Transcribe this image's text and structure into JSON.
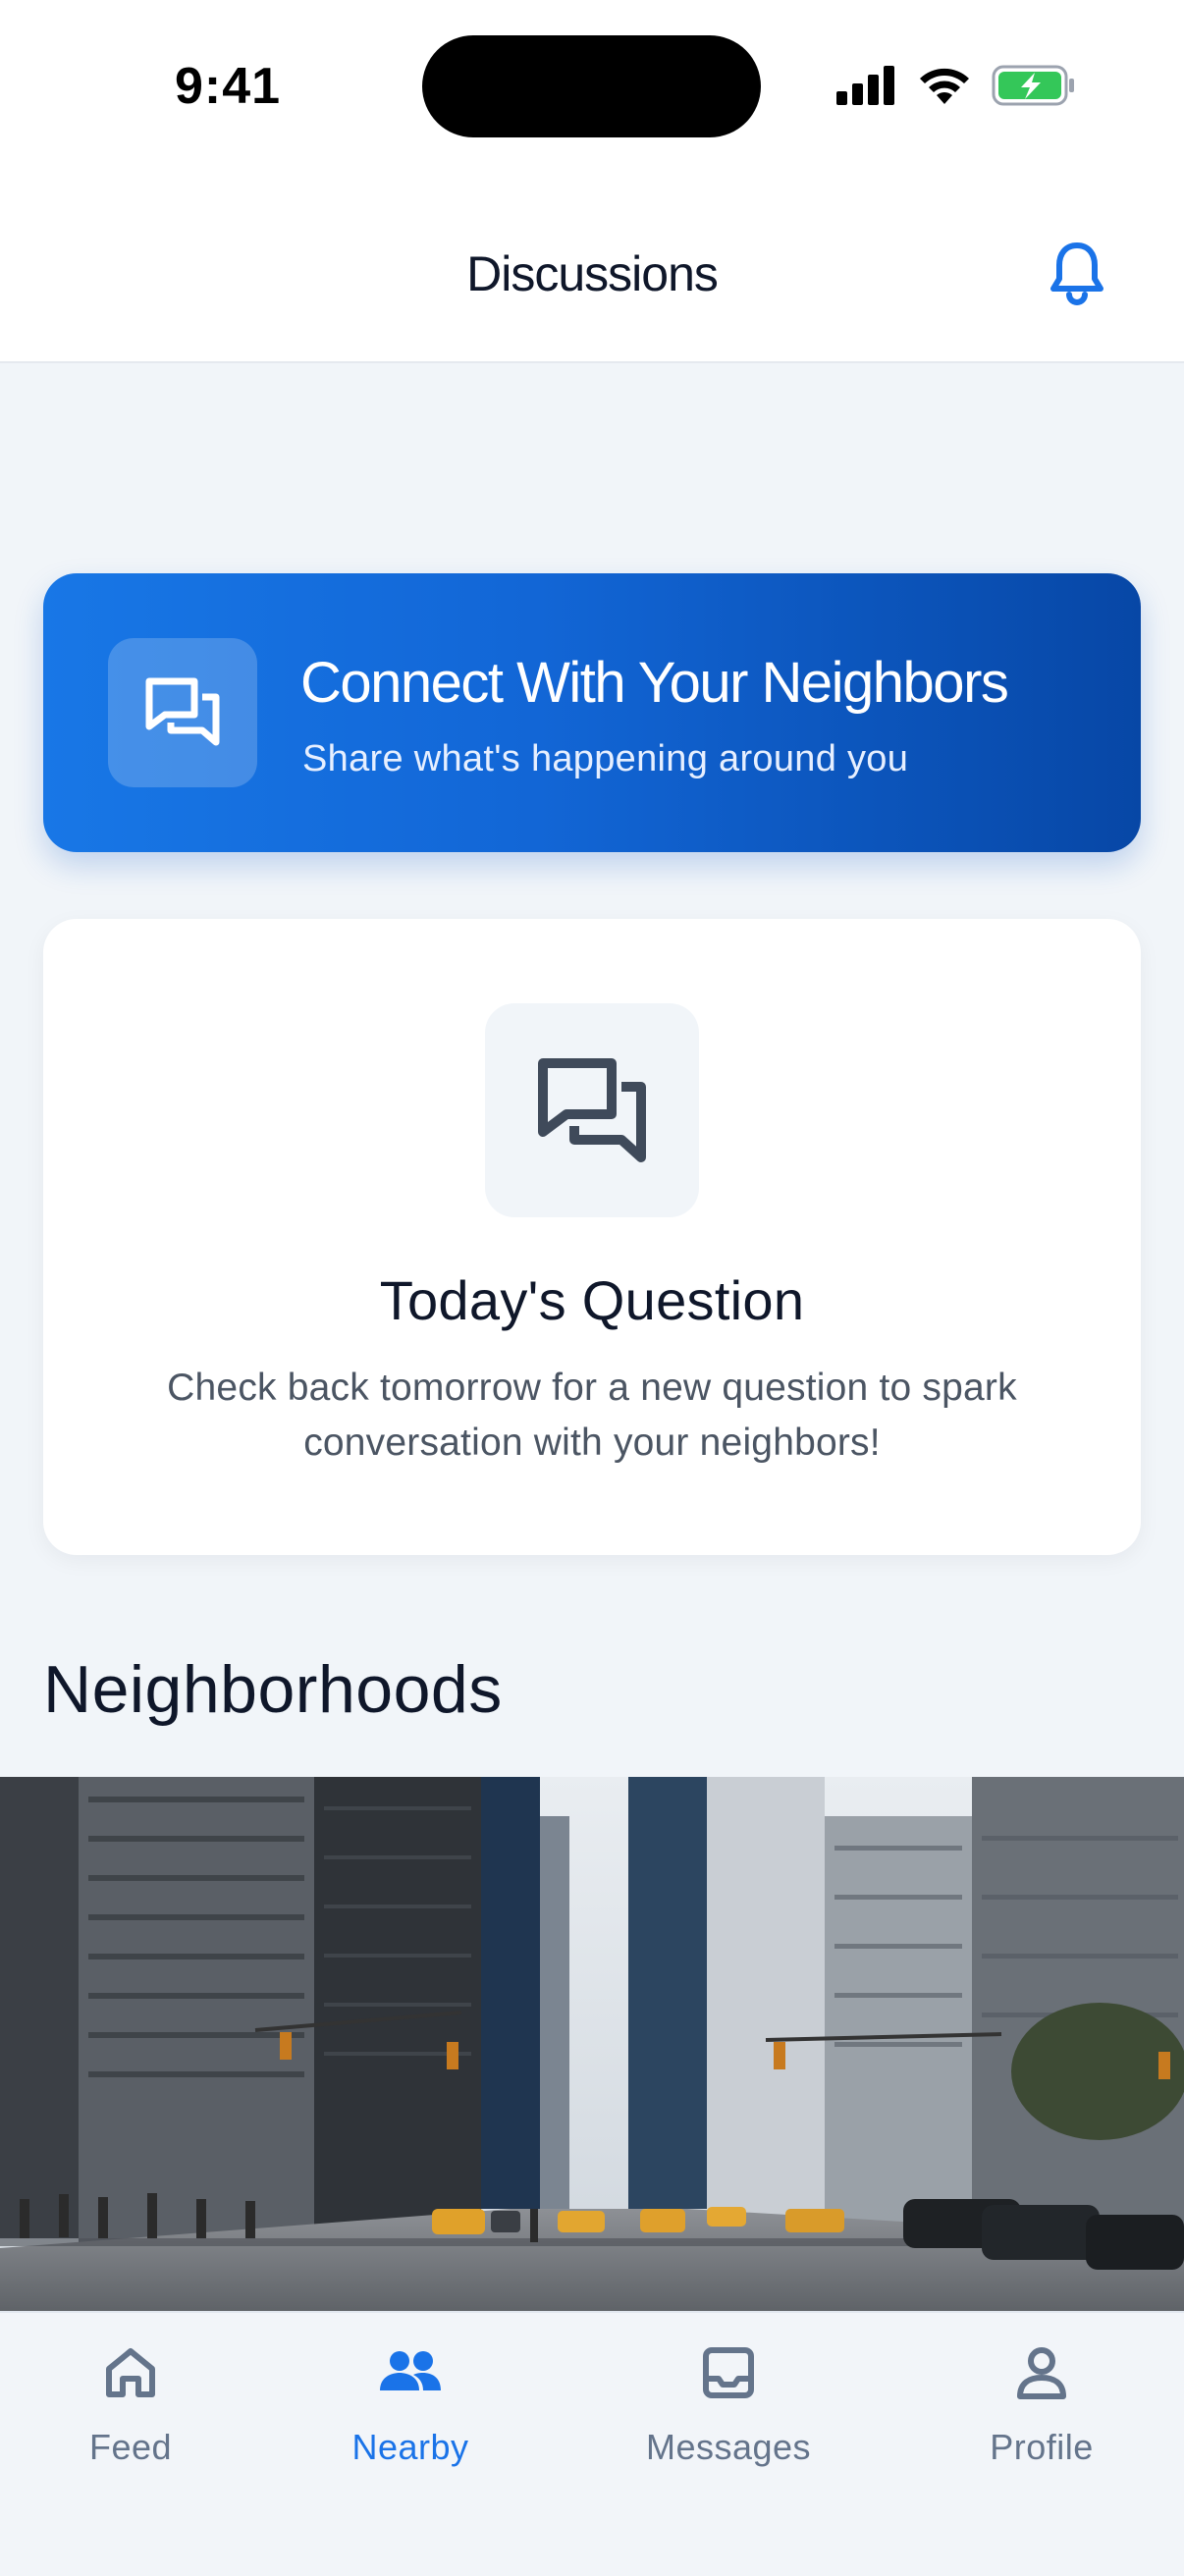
{
  "status_bar": {
    "time": "9:41"
  },
  "header": {
    "title": "Discussions"
  },
  "hero": {
    "title": "Connect With Your Neighbors",
    "subtitle": "Share what's happening around you"
  },
  "question_card": {
    "title": "Today's Question",
    "text": "Check back tomorrow for a new question to spark conversation with your neighbors!"
  },
  "section": {
    "title": "Neighborhoods"
  },
  "tab_bar": {
    "tabs": [
      {
        "label": "Feed",
        "icon": "home-icon",
        "active": false
      },
      {
        "label": "Nearby",
        "icon": "people-icon",
        "active": true
      },
      {
        "label": "Messages",
        "icon": "inbox-icon",
        "active": false
      },
      {
        "label": "Profile",
        "icon": "person-icon",
        "active": false
      }
    ]
  },
  "colors": {
    "accent": "#1a73e8",
    "hero_gradient_start": "#1877e6",
    "hero_gradient_end": "#0747a6",
    "battery": "#34c759"
  }
}
